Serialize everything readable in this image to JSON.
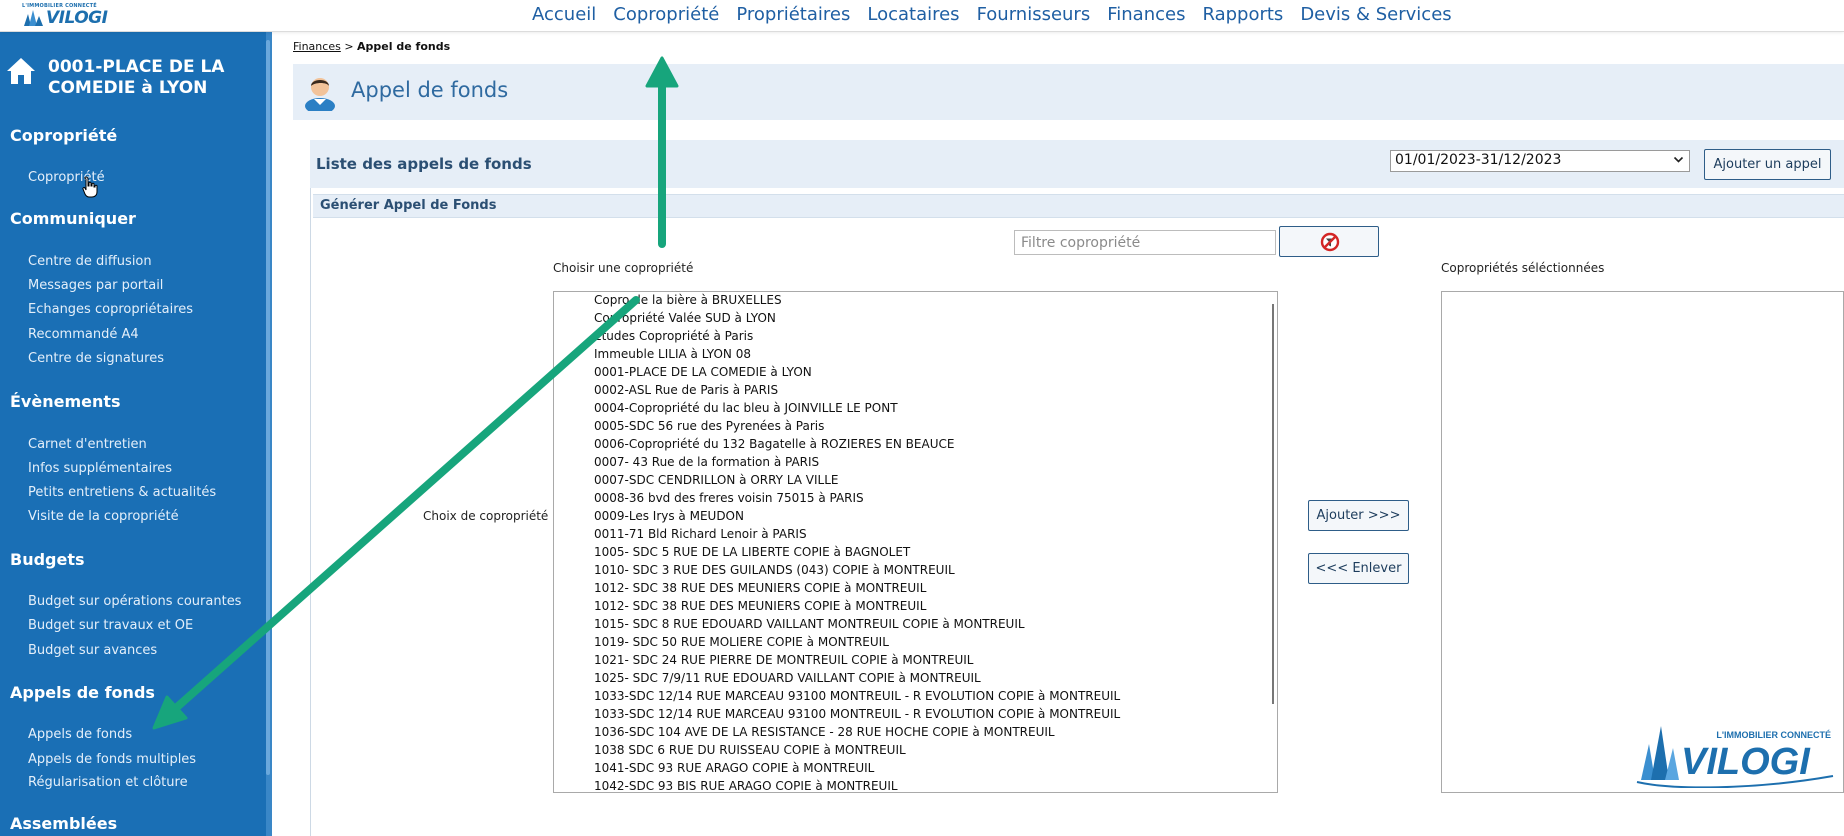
{
  "header": {
    "logo_tagline": "L'IMMOBILIER CONNECTÉ",
    "logo_brand": "VILOGI",
    "nav": [
      "Accueil",
      "Copropriété",
      "Propriétaires",
      "Locataires",
      "Fournisseurs",
      "Finances",
      "Rapports",
      "Devis & Services"
    ]
  },
  "sidebar": {
    "copro_name": "0001-PLACE DE LA COMEDIE à LYON",
    "sections": [
      {
        "title": "Copropriété",
        "items": [
          "Copropriété"
        ]
      },
      {
        "title": "Communiquer",
        "items": [
          "Centre de diffusion",
          "Messages par portail",
          "Echanges copropriétaires",
          "Recommandé A4",
          "Centre de signatures"
        ]
      },
      {
        "title": "Évènements",
        "items": [
          "Carnet d'entretien",
          "Infos supplémentaires",
          "Petits entretiens & actualités",
          "Visite de la copropriété"
        ]
      },
      {
        "title": "Budgets",
        "items": [
          "Budget sur opérations courantes",
          "Budget sur travaux et OE",
          "Budget sur avances"
        ]
      },
      {
        "title": "Appels de fonds",
        "items": [
          "Appels de fonds",
          "Appels de fonds multiples",
          "Régularisation et clôture"
        ]
      },
      {
        "title": "Assemblées",
        "items": []
      }
    ]
  },
  "breadcrumb": {
    "parent": "Finances",
    "separator": " > ",
    "current": "Appel de fonds"
  },
  "page_title": "Appel de fonds",
  "liste": {
    "title": "Liste des appels de fonds",
    "period": "01/01/2023-31/12/2023",
    "add_button": "Ajouter un appel"
  },
  "generer": {
    "title": "Générer Appel de Fonds",
    "filter_placeholder": "Filtre copropriété",
    "choose_label": "Choisir une copropriété",
    "choix_label": "Choix de copropriété",
    "selected_label": "Copropriétés séléctionnées",
    "add_btn": "Ajouter >>>",
    "remove_btn": "<<< Enlever",
    "options": [
      "Copro de la bière à BRUXELLES",
      "Copropriété Valée SUD à LYON",
      "Etudes Copropriété à Paris",
      "Immeuble LILIA à LYON 08",
      "0001-PLACE DE LA COMEDIE à LYON",
      "0002-ASL Rue de Paris à PARIS",
      "0004-Copropriété du lac bleu à JOINVILLE LE PONT",
      "0005-SDC 56 rue des Pyrenées à Paris",
      "0006-Copropriété du 132 Bagatelle à ROZIERES EN BEAUCE",
      "0007- 43 Rue de la formation à PARIS",
      "0007-SDC CENDRILLON à ORRY LA VILLE",
      "0008-36 bvd des freres voisin 75015 à PARIS",
      "0009-Les Irys à MEUDON",
      "0011-71 Bld Richard Lenoir à PARIS",
      "1005- SDC 5 RUE DE LA LIBERTE COPIE à BAGNOLET",
      "1010- SDC 3 RUE DES GUILANDS (043) COPIE à MONTREUIL",
      "1012- SDC 38 RUE DES MEUNIERS COPIE à MONTREUIL",
      "1012- SDC 38 RUE DES MEUNIERS COPIE à MONTREUIL",
      "1015- SDC 8 RUE EDOUARD VAILLANT MONTREUIL COPIE à MONTREUIL",
      "1019- SDC 50 RUE MOLIERE COPIE à MONTREUIL",
      "1021- SDC 24 RUE PIERRE DE MONTREUIL COPIE à MONTREUIL",
      "1025- SDC 7/9/11 RUE EDOUARD VAILLANT COPIE à MONTREUIL",
      "1033-SDC 12/14 RUE MARCEAU 93100 MONTREUIL - R EVOLUTION COPIE à MONTREUIL",
      "1033-SDC 12/14 RUE MARCEAU 93100 MONTREUIL - R EVOLUTION COPIE à MONTREUIL",
      "1036-SDC 104 AVE DE LA RESISTANCE - 28 RUE HOCHE COPIE à MONTREUIL",
      "1038 SDC 6 RUE DU RUISSEAU COPIE à MONTREUIL",
      "1041-SDC 93 RUE ARAGO COPIE à MONTREUIL",
      "1042-SDC 93 BIS RUE ARAGO COPIE à MONTREUIL"
    ]
  },
  "colors": {
    "sidebar": "#1a6fb5",
    "nav_link": "#1f5fa3",
    "arrow": "#17a57c",
    "band": "#e6eef7"
  },
  "icons": [
    "house-icon",
    "person-icon",
    "cursor-icon",
    "clear-filter-icon",
    "chevron-down-icon"
  ]
}
